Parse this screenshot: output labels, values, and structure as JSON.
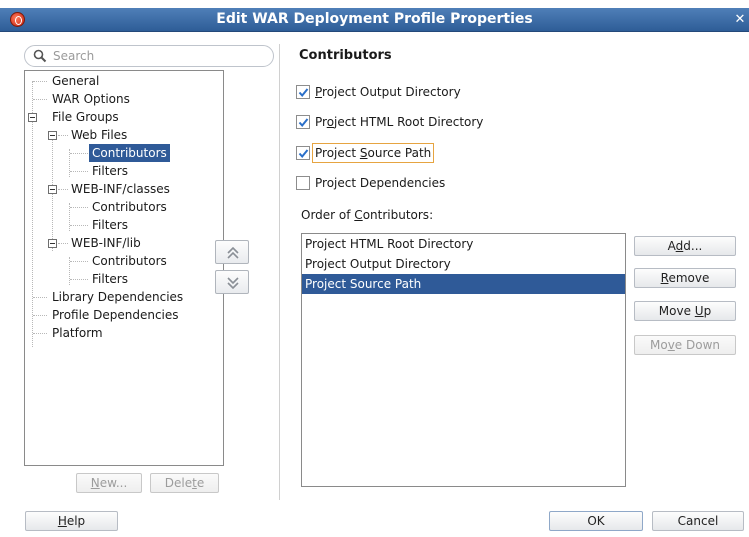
{
  "window": {
    "title": "Edit WAR Deployment Profile Properties",
    "close_label": "✕"
  },
  "search": {
    "placeholder": "Search"
  },
  "tree": {
    "items": [
      {
        "label": "General",
        "level": 0
      },
      {
        "label": "WAR Options",
        "level": 0
      },
      {
        "label": "File Groups",
        "level": 0,
        "expanded": true
      },
      {
        "label": "Web Files",
        "level": 1,
        "expanded": true
      },
      {
        "label": "Contributors",
        "level": 2,
        "selected": true
      },
      {
        "label": "Filters",
        "level": 2
      },
      {
        "label": "WEB-INF/classes",
        "level": 1,
        "expanded": true
      },
      {
        "label": "Contributors",
        "level": 2
      },
      {
        "label": "Filters",
        "level": 2
      },
      {
        "label": "WEB-INF/lib",
        "level": 1,
        "expanded": true
      },
      {
        "label": "Contributors",
        "level": 2
      },
      {
        "label": "Filters",
        "level": 2
      },
      {
        "label": "Library Dependencies",
        "level": 0
      },
      {
        "label": "Profile Dependencies",
        "level": 0
      },
      {
        "label": "Platform",
        "level": 0
      }
    ],
    "new_button": {
      "pre": "",
      "mnemonic": "N",
      "post": "ew..."
    },
    "delete_button": {
      "pre": "Dele",
      "mnemonic": "t",
      "post": "e"
    }
  },
  "section": {
    "title": "Contributors"
  },
  "checkboxes": [
    {
      "pre": "",
      "mnemonic": "P",
      "post": "roject Output Directory",
      "checked": true
    },
    {
      "pre": "Pr",
      "mnemonic": "o",
      "post": "ject HTML Root Directory",
      "checked": true
    },
    {
      "pre": "Project ",
      "mnemonic": "S",
      "post": "ource Path",
      "checked": true,
      "focused": true
    },
    {
      "pre": "Project Dependencies",
      "mnemonic": "",
      "post": "",
      "checked": false
    }
  ],
  "order": {
    "label_pre": "Order of ",
    "label_mnemonic": "C",
    "label_post": "ontributors:",
    "items": [
      {
        "label": "Project HTML Root Directory"
      },
      {
        "label": "Project Output Directory"
      },
      {
        "label": "Project Source Path",
        "selected": true
      }
    ],
    "buttons": {
      "add": {
        "pre": "A",
        "mnemonic": "d",
        "post": "d..."
      },
      "remove": {
        "pre": "",
        "mnemonic": "R",
        "post": "emove"
      },
      "move_up": {
        "pre": "Move ",
        "mnemonic": "U",
        "post": "p"
      },
      "move_down": {
        "pre": "Mo",
        "mnemonic": "v",
        "post": "e Down"
      }
    }
  },
  "footer": {
    "help": {
      "pre": "",
      "mnemonic": "H",
      "post": "elp"
    },
    "ok": "OK",
    "cancel": "Cancel"
  },
  "colors": {
    "title_bar": "#2e5d97",
    "selection": "#2f5a98",
    "focus_border": "#e6a441",
    "check": "#2a6fc9"
  }
}
